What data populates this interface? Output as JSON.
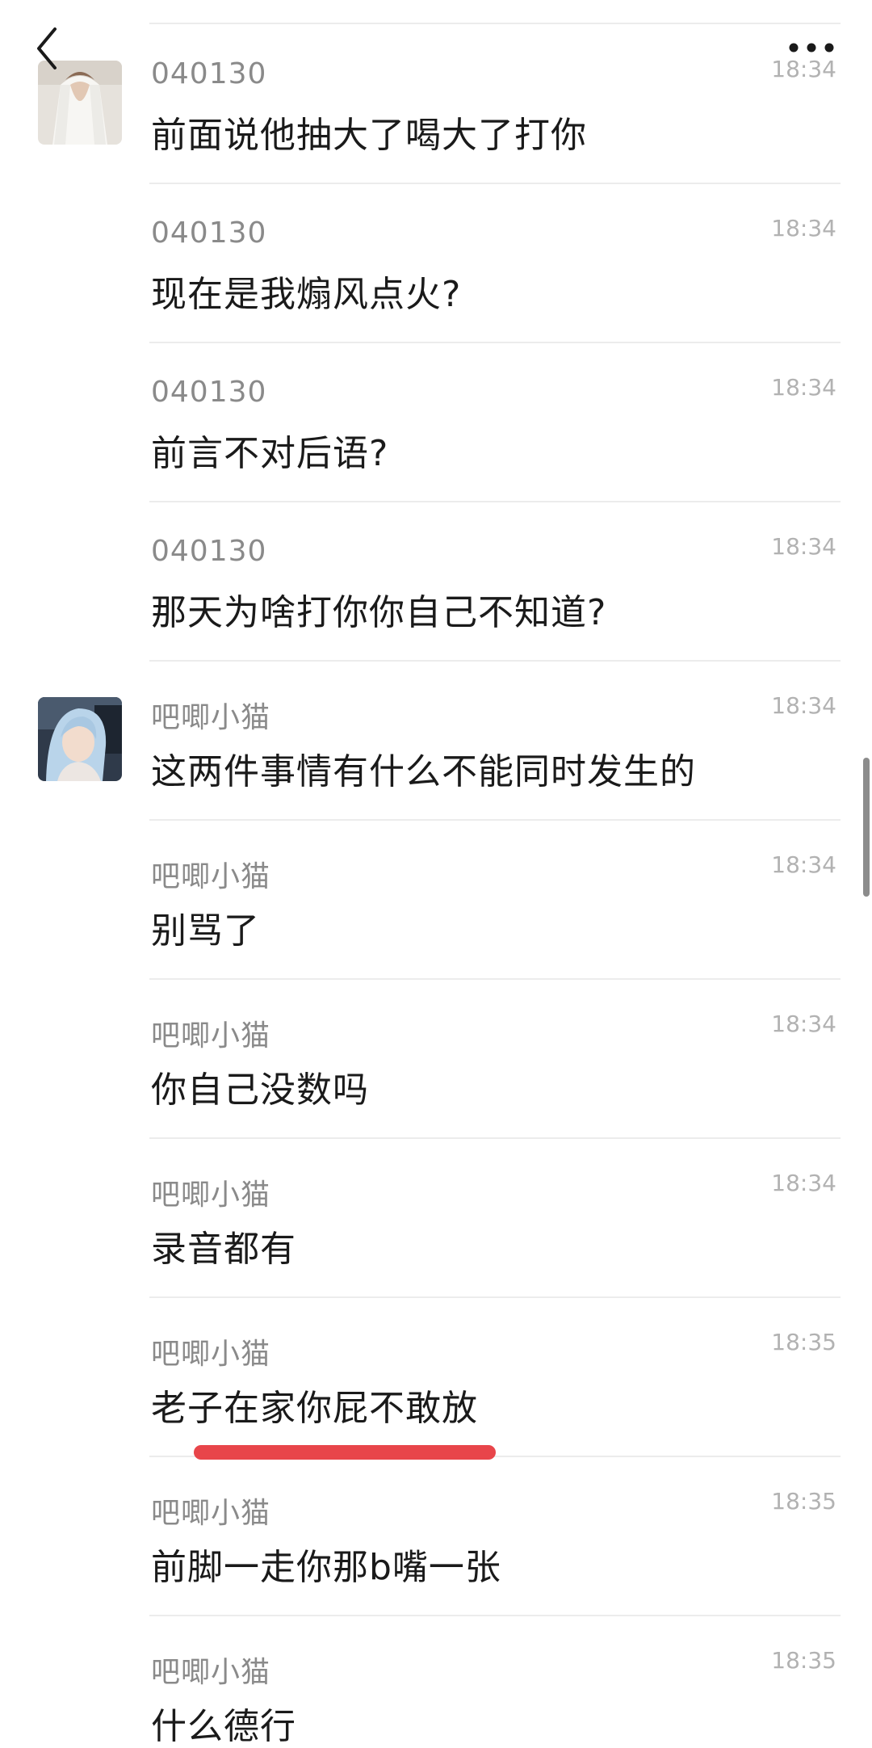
{
  "messages": [
    {
      "sender": "040130",
      "time": "18:34",
      "text": "前面说他抽大了喝大了打你",
      "avatar": "avatar-white-dress"
    },
    {
      "sender": "040130",
      "time": "18:34",
      "text": "现在是我煽风点火?"
    },
    {
      "sender": "040130",
      "time": "18:34",
      "text": "前言不对后语?"
    },
    {
      "sender": "040130",
      "time": "18:34",
      "text": "那天为啥打你你自己不知道?"
    },
    {
      "sender": "吧唧小猫",
      "time": "18:34",
      "text": "这两件事情有什么不能同时发生的",
      "avatar": "avatar-blue-hair"
    },
    {
      "sender": "吧唧小猫",
      "time": "18:34",
      "text": "别骂了"
    },
    {
      "sender": "吧唧小猫",
      "time": "18:34",
      "text": "你自己没数吗"
    },
    {
      "sender": "吧唧小猫",
      "time": "18:34",
      "text": "录音都有"
    },
    {
      "sender": "吧唧小猫",
      "time": "18:35",
      "text": "老子在家你屁不敢放"
    },
    {
      "sender": "吧唧小猫",
      "time": "18:35",
      "text": "前脚一走你那b嘴一张"
    },
    {
      "sender": "吧唧小猫",
      "time": "18:35",
      "text": "什么德行"
    }
  ],
  "colors": {
    "sender": "#8a8a8a",
    "time": "#b2b2b2",
    "text": "#1a1a1a",
    "divider": "#ececec",
    "highlight": "#e8454a"
  },
  "icons": {
    "back": "chevron-left-icon",
    "more": "more-dots-icon"
  }
}
